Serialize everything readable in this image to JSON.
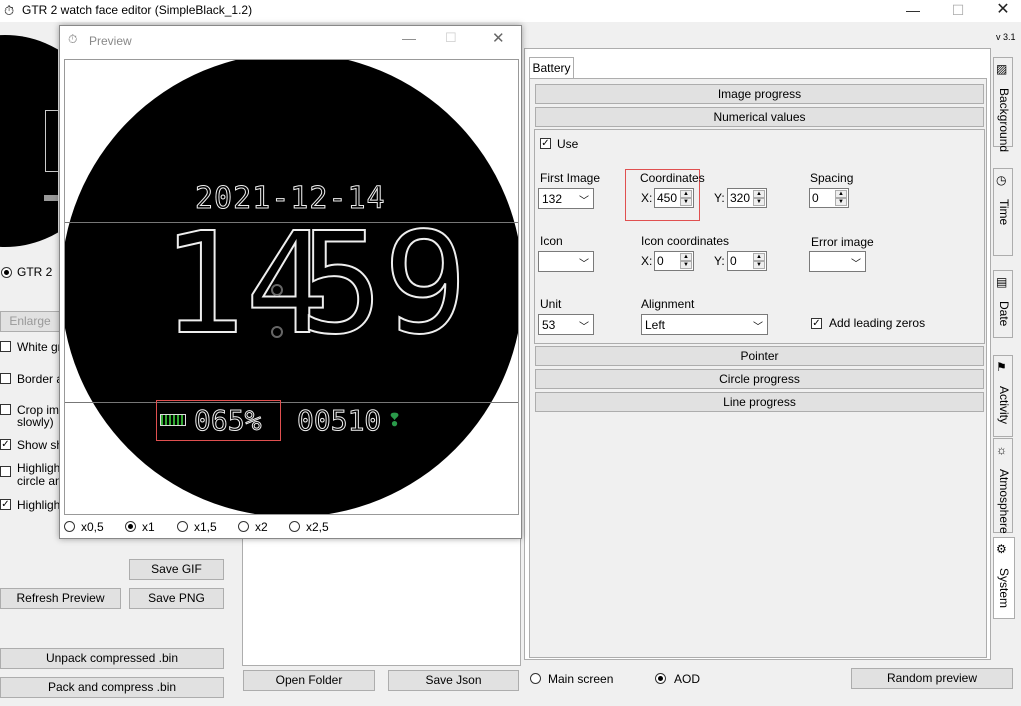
{
  "window": {
    "title": "GTR 2 watch face editor (SimpleBlack_1.2)",
    "version": "v 3.1"
  },
  "left": {
    "model_label": "GTR 2",
    "enlarge_label": "Enlarge",
    "options": [
      {
        "label": "White gri",
        "checked": false
      },
      {
        "label": "Border ar",
        "checked": false
      },
      {
        "label": "Crop imag",
        "label2": "slowly)",
        "checked": false
      },
      {
        "label": "Show sho",
        "checked": true
      },
      {
        "label": "Highlight",
        "label2": "circle and",
        "checked": false
      },
      {
        "label": "Highlight",
        "checked": true
      }
    ],
    "save_gif": "Save GIF",
    "refresh": "Refresh Preview",
    "save_png": "Save PNG",
    "unpack": "Unpack compressed .bin",
    "pack": "Pack and compress .bin",
    "open_folder": "Open Folder",
    "save_json": "Save Json"
  },
  "preview": {
    "title": "Preview",
    "date": "2021-12-14",
    "time_h": "14",
    "time_m": "59",
    "battery": "065%",
    "steps": "00510",
    "zoom": [
      {
        "label": "x0,5",
        "selected": false
      },
      {
        "label": "x1",
        "selected": true
      },
      {
        "label": "x1,5",
        "selected": false
      },
      {
        "label": "x2",
        "selected": false
      },
      {
        "label": "x2,5",
        "selected": false
      }
    ]
  },
  "battery": {
    "tab": "Battery",
    "image_progress": "Image progress",
    "numerical_values": "Numerical values",
    "use_label": "Use",
    "first_image_label": "First Image",
    "first_image_value": "132",
    "coordinates_label": "Coordinates",
    "x_label": "X:",
    "x_value": "450",
    "y_label": "Y:",
    "y_value": "320",
    "spacing_label": "Spacing",
    "spacing_value": "0",
    "icon_label": "Icon",
    "icon_coords_label": "Icon coordinates",
    "icon_x_label": "X:",
    "icon_x_value": "0",
    "icon_y_label": "Y:",
    "icon_y_value": "0",
    "error_image_label": "Error image",
    "unit_label": "Unit",
    "unit_value": "53",
    "alignment_label": "Alignment",
    "alignment_value": "Left",
    "leading_zeros_label": "Add leading zeros",
    "pointer": "Pointer",
    "circle_progress": "Circle progress",
    "line_progress": "Line progress"
  },
  "screen_mode": {
    "main": "Main screen",
    "aod": "AOD",
    "random": "Random preview"
  },
  "side_tabs": [
    "Background",
    "Time",
    "Date",
    "Activity",
    "Atmosphere",
    "System"
  ],
  "colors": {
    "highlight": "#e05050",
    "accent": "#2a9a4a"
  }
}
